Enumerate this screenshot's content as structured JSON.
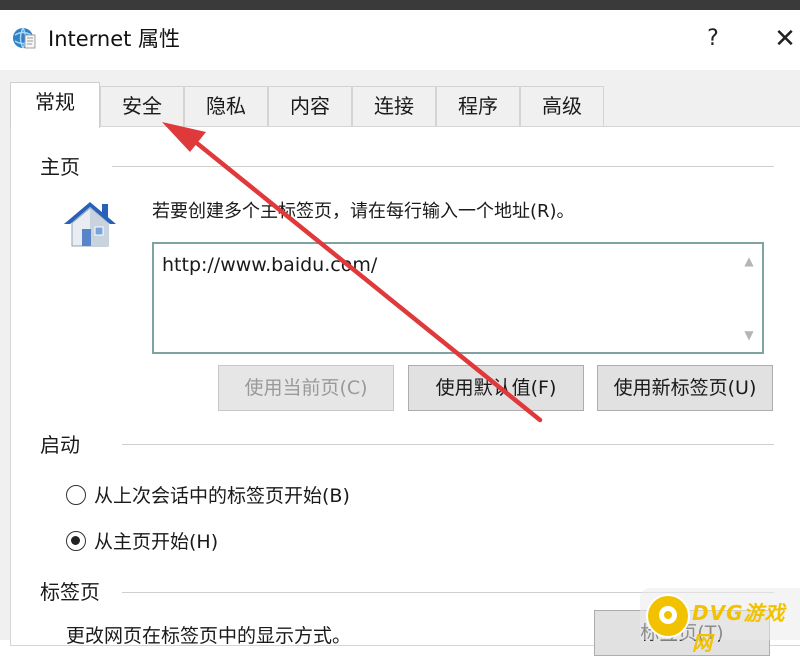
{
  "window": {
    "title": "Internet 属性",
    "help_label": "?",
    "close_label": "✕"
  },
  "tabs": [
    {
      "label": "常规",
      "active": true
    },
    {
      "label": "安全"
    },
    {
      "label": "隐私"
    },
    {
      "label": "内容"
    },
    {
      "label": "连接"
    },
    {
      "label": "程序"
    },
    {
      "label": "高级"
    }
  ],
  "home": {
    "group_label": "主页",
    "hint": "若要创建多个主标签页，请在每行输入一个地址(R)。",
    "url": "http://www.baidu.com/",
    "buttons": {
      "use_current": "使用当前页(C)",
      "use_default": "使用默认值(F)",
      "use_new_tab": "使用新标签页(U)"
    }
  },
  "startup": {
    "group_label": "启动",
    "options": [
      {
        "label": "从上次会话中的标签页开始(B)",
        "checked": false
      },
      {
        "label": "从主页开始(H)",
        "checked": true
      }
    ]
  },
  "tabs_section": {
    "group_label": "标签页",
    "description": "更改网页在标签页中的显示方式。",
    "button": "标签页(T)"
  },
  "icons": {
    "app": "ie-globe-icon",
    "home": "house-icon",
    "scroll_up": "chevron-up-icon",
    "scroll_down": "chevron-down-icon",
    "watermark": "dvg-logo-icon"
  },
  "annotation": {
    "arrow_color": "#e0393b"
  },
  "watermark": {
    "text": "DVG游戏网"
  }
}
